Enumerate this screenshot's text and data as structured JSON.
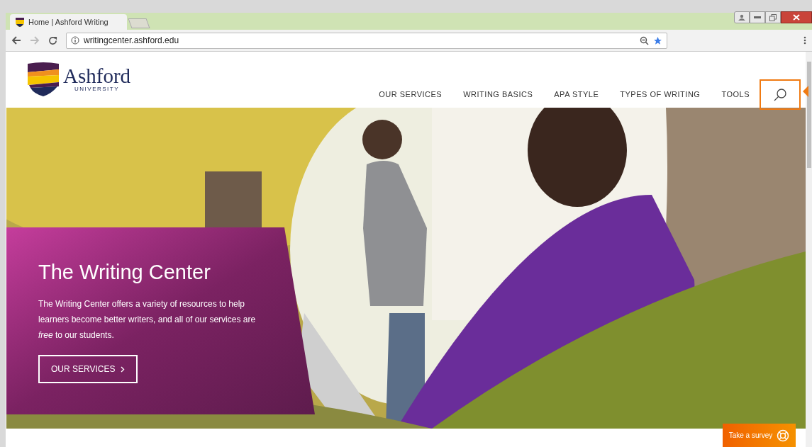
{
  "browser": {
    "tab_title": "Home | Ashford Writing",
    "url": "writingcenter.ashford.edu"
  },
  "logo": {
    "name": "Ashford",
    "subtitle": "UNIVERSITY"
  },
  "nav": [
    {
      "label": "OUR SERVICES"
    },
    {
      "label": "WRITING BASICS"
    },
    {
      "label": "APA STYLE"
    },
    {
      "label": "TYPES OF WRITING"
    },
    {
      "label": "TOOLS"
    }
  ],
  "search": {
    "highlighted": true
  },
  "hero": {
    "title": "The Writing Center",
    "text": "The Writing Center offers a variety of resources to help learners become better writers, and all of our services are *free* to our students.",
    "button": "OUR SERVICES"
  },
  "survey": {
    "label": "Take a survey"
  }
}
